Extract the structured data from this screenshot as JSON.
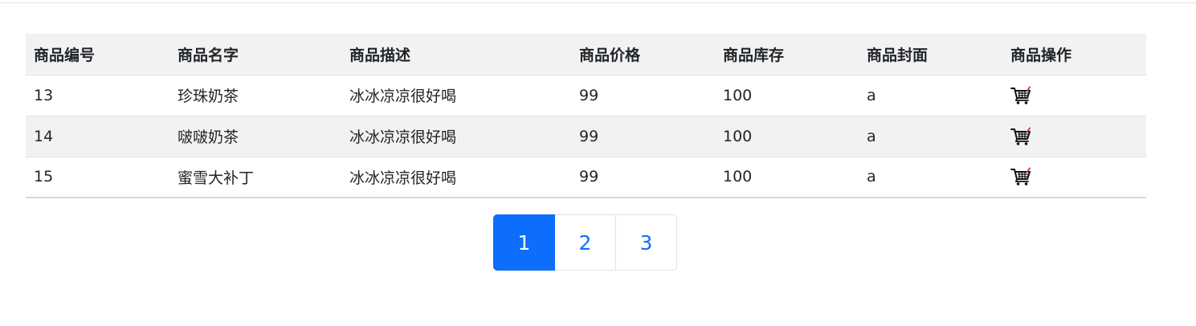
{
  "table": {
    "headers": [
      "商品编号",
      "商品名字",
      "商品描述",
      "商品价格",
      "商品库存",
      "商品封面",
      "商品操作"
    ],
    "rows": [
      {
        "id": "13",
        "name": "珍珠奶茶",
        "description": "冰冰凉凉很好喝",
        "price": "99",
        "stock": "100",
        "cover": "a",
        "action_icon": "shopping-cart-icon"
      },
      {
        "id": "14",
        "name": "啵啵奶茶",
        "description": "冰冰凉凉很好喝",
        "price": "99",
        "stock": "100",
        "cover": "a",
        "action_icon": "shopping-cart-icon"
      },
      {
        "id": "15",
        "name": "蜜雪大补丁",
        "description": "冰冰凉凉很好喝",
        "price": "99",
        "stock": "100",
        "cover": "a",
        "action_icon": "shopping-cart-icon"
      }
    ]
  },
  "pagination": {
    "pages": [
      "1",
      "2",
      "3"
    ],
    "active": "1"
  },
  "colors": {
    "accent": "#0d6efd",
    "header_bg": "#f2f2f2",
    "stripe_bg": "#f2f2f2",
    "cart_accent": "#d6336c"
  }
}
